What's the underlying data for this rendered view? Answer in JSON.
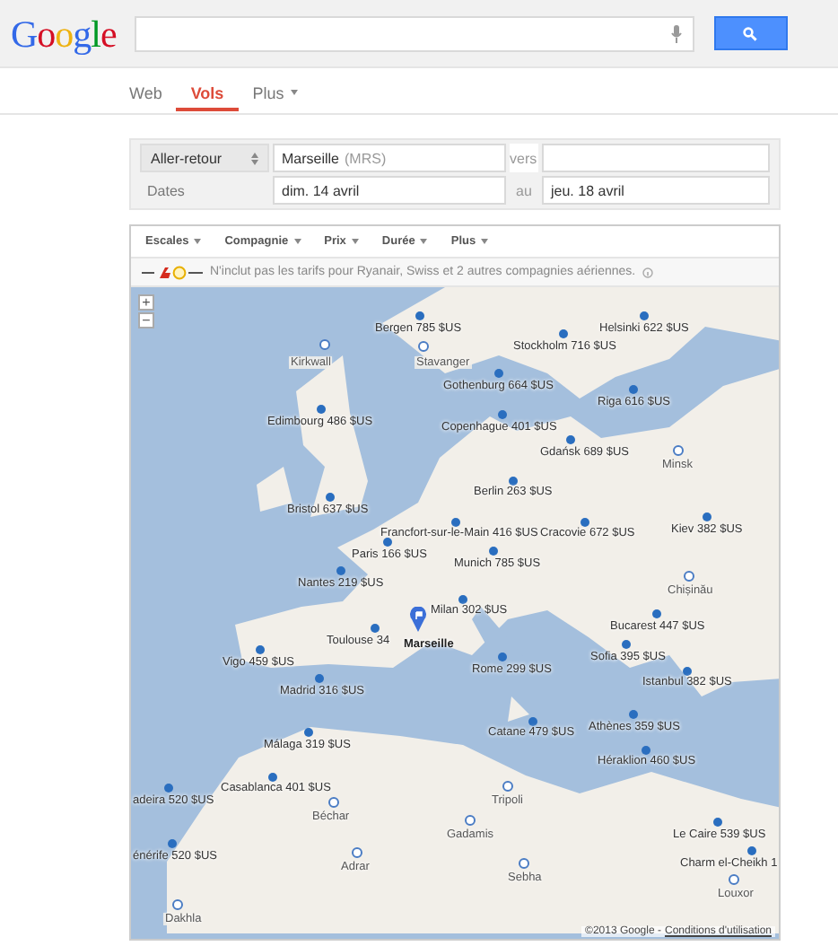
{
  "logo": "Google",
  "nav_tabs": [
    {
      "label": "Web",
      "selected": false,
      "dropdown": false
    },
    {
      "label": "Vols",
      "selected": true,
      "dropdown": false
    },
    {
      "label": "Plus",
      "selected": false,
      "dropdown": true
    }
  ],
  "search_form": {
    "trip_type": "Aller-retour",
    "origin": {
      "city": "Marseille",
      "code": "(MRS)"
    },
    "to_label": "vers",
    "dates_label": "Dates",
    "departure": "dim. 14 avril",
    "between_label": "au",
    "return": "jeu. 18 avril"
  },
  "filters": [
    "Escales",
    "Compagnie",
    "Prix",
    "Durée",
    "Plus"
  ],
  "notice": "N'inclut pas les tarifs pour Ryanair, Swiss et 2 autres compagnies aériennes.",
  "map": {
    "zoom_in": "+",
    "zoom_out": "−",
    "footer": "©2013 Google -",
    "terms_link": "Conditions d'utilisation",
    "pins": [
      {
        "kind": "price",
        "label": "Bergen 785 $US"
      },
      {
        "kind": "price",
        "label": "Helsinki 622 $US"
      },
      {
        "kind": "price",
        "label": "Stockholm 716 $US"
      },
      {
        "kind": "price",
        "label": "Gothenburg 664 $US"
      },
      {
        "kind": "price",
        "label": "Riga 616 $US"
      },
      {
        "kind": "price",
        "label": "Edimbourg 486 $US"
      },
      {
        "kind": "price",
        "label": "Copenhague 401 $US"
      },
      {
        "kind": "price",
        "label": "Gdańsk 689 $US"
      },
      {
        "kind": "price",
        "label": "Berlin 263 $US"
      },
      {
        "kind": "price",
        "label": "Bristol 637 $US"
      },
      {
        "kind": "price",
        "label": "Francfort-sur-le-Main 416 $US"
      },
      {
        "kind": "price",
        "label": "Cracovie 672 $US"
      },
      {
        "kind": "price",
        "label": "Kiev 382 $US"
      },
      {
        "kind": "price",
        "label": "Paris 166 $US"
      },
      {
        "kind": "price",
        "label": "Munich 785 $US"
      },
      {
        "kind": "price",
        "label": "Nantes 219 $US"
      },
      {
        "kind": "price",
        "label": "Milan 302 $US"
      },
      {
        "kind": "price",
        "label": "Bucarest 447 $US"
      },
      {
        "kind": "price",
        "label": "Toulouse 34"
      },
      {
        "kind": "price",
        "label": "Vigo 459 $US"
      },
      {
        "kind": "price",
        "label": "Sofia 395 $US"
      },
      {
        "kind": "price",
        "label": "Rome 299 $US"
      },
      {
        "kind": "price",
        "label": "Istanbul 382 $US"
      },
      {
        "kind": "price",
        "label": "Madrid 316 $US"
      },
      {
        "kind": "price",
        "label": "Athènes 359 $US"
      },
      {
        "kind": "price",
        "label": "Catane 479 $US"
      },
      {
        "kind": "price",
        "label": "Málaga 319 $US"
      },
      {
        "kind": "price",
        "label": "Héraklion 460 $US"
      },
      {
        "kind": "price",
        "label": "Casablanca 401 $US"
      },
      {
        "kind": "price",
        "label": "adeira 520 $US"
      },
      {
        "kind": "price",
        "label": "Le Caire 539 $US"
      },
      {
        "kind": "price",
        "label": "énérife 520 $US"
      },
      {
        "kind": "price",
        "label": "Charm el-Cheikh 1"
      },
      {
        "kind": "airport",
        "label": "Kirkwall"
      },
      {
        "kind": "airport",
        "label": "Stavanger"
      },
      {
        "kind": "airport",
        "label": "Minsk"
      },
      {
        "kind": "airport",
        "label": "Chișinău"
      },
      {
        "kind": "airport",
        "label": "Béchar"
      },
      {
        "kind": "airport",
        "label": "Tripoli"
      },
      {
        "kind": "airport",
        "label": "Gadamis"
      },
      {
        "kind": "airport",
        "label": "Adrar"
      },
      {
        "kind": "airport",
        "label": "Sebha"
      },
      {
        "kind": "airport",
        "label": "Louxor"
      },
      {
        "kind": "airport",
        "label": "Dakhla"
      },
      {
        "kind": "origin",
        "label": "Marseille"
      }
    ]
  }
}
